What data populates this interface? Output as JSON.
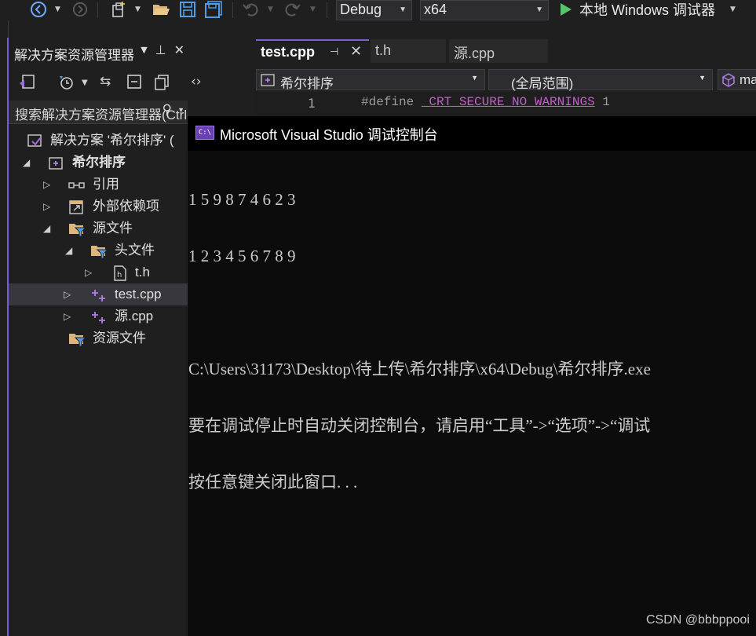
{
  "toolbar": {
    "config": "Debug",
    "platform": "x64",
    "run_label": "本地 Windows 调试器",
    "icons": [
      "back-icon",
      "forward-icon",
      "new-project-icon",
      "open-folder-icon",
      "save-icon",
      "save-all-icon",
      "undo-icon",
      "redo-icon",
      "play-icon"
    ]
  },
  "solution_explorer": {
    "title": "解决方案资源管理器",
    "search_placeholder": "搜索解决方案资源管理器(Ctrl-",
    "tree": {
      "solution": "解决方案 '希尔排序' (",
      "project": "希尔排序",
      "references": "引用",
      "external_deps": "外部依赖项",
      "source_files": "源文件",
      "header_files": "头文件",
      "th": "t.h",
      "test_cpp": "test.cpp",
      "yuan_cpp": "源.cpp",
      "resource_files": "资源文件"
    }
  },
  "editor": {
    "tabs": [
      {
        "label": "test.cpp",
        "active": true
      },
      {
        "label": "t.h",
        "active": false
      },
      {
        "label": "源.cpp",
        "active": false
      }
    ],
    "nav": {
      "project": "希尔排序",
      "scope": "(全局范围)",
      "member": "ma"
    },
    "line_number": "1",
    "code_directive": "#define",
    "code_macro": "_CRT_SECURE_NO_WARNINGS",
    "code_value": "1"
  },
  "console": {
    "icon_text": "C:\\",
    "title": "Microsoft Visual Studio 调试控制台",
    "lines": [
      "1 5 9 8 7 4 6 2 3",
      "1 2 3 4 5 6 7 8 9",
      "",
      "C:\\Users\\31173\\Desktop\\待上传\\希尔排序\\x64\\Debug\\希尔排序.exe",
      "要在调试停止时自动关闭控制台，请启用“工具”->“选项”->“调试",
      "按任意键关闭此窗口. . ."
    ]
  },
  "watermark": "CSDN @bbbppooi",
  "colors": {
    "accent": "#7b5fd1",
    "run_green": "#58c468",
    "console_bg": "#0c0c0c",
    "ide_bg": "#1f1f1f"
  }
}
